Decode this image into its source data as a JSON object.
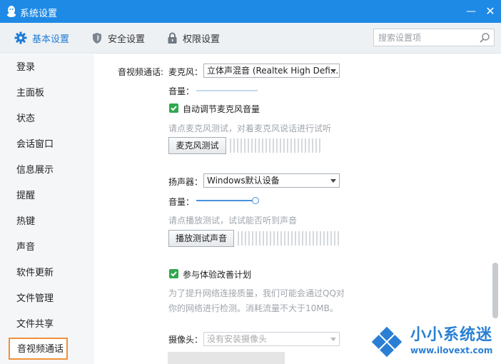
{
  "window": {
    "title": "系统设置",
    "minimize": "—",
    "close": "✕"
  },
  "tabs": [
    {
      "label": "基本设置",
      "icon": "gear-icon",
      "active": true
    },
    {
      "label": "安全设置",
      "icon": "shield-icon"
    },
    {
      "label": "权限设置",
      "icon": "lock-icon"
    }
  ],
  "search": {
    "placeholder": "搜索设置项",
    "icon": "search-icon"
  },
  "sidebar": {
    "items": [
      {
        "label": "登录"
      },
      {
        "label": "主面板"
      },
      {
        "label": "状态"
      },
      {
        "label": "会话窗口"
      },
      {
        "label": "信息展示"
      },
      {
        "label": "提醒"
      },
      {
        "label": "热键"
      },
      {
        "label": "声音"
      },
      {
        "label": "软件更新"
      },
      {
        "label": "文件管理"
      },
      {
        "label": "文件共享"
      },
      {
        "label": "音视频通话",
        "active": true
      }
    ]
  },
  "content": {
    "section_label": "音视频通话:",
    "mic": {
      "label": "麦克风：",
      "selected": "立体声混音 (Realtek High Defi...",
      "volume_label": "音量：",
      "auto_adjust_label": "自动调节麦克风音量",
      "auto_adjust_checked": true,
      "hint": "请点麦克风测试，对着麦克风说话进行试听",
      "test_button": "麦克风测试"
    },
    "speaker": {
      "label": "扬声器：",
      "selected": "Windows默认设备",
      "volume_label": "音量：",
      "volume_level": 1.0,
      "hint": "请点播放测试，试试能否听到声音",
      "test_button": "播放测试声音"
    },
    "experience": {
      "label": "参与体验改善计划",
      "checked": true,
      "desc_line1": "为了提升网络连接质量，我们可能会通过QQ对",
      "desc_line2": "你的网络进行检测。消耗流量不大于10MB。"
    },
    "camera": {
      "label": "摄像头：",
      "selected": "没有安装摄像头"
    }
  },
  "watermark": {
    "title": "小小系统迷",
    "url": "www.ilovext.com"
  },
  "colors": {
    "titlebar": "#1e8ae6",
    "accent": "#1f7cd6",
    "active_outline": "#f0913a",
    "check": "#2fa84f"
  }
}
